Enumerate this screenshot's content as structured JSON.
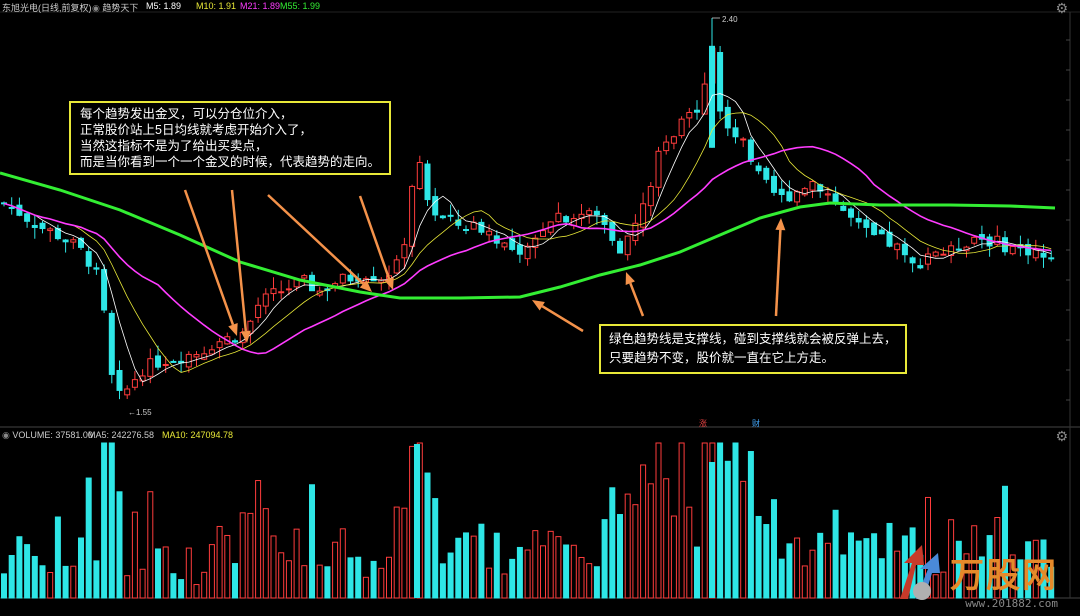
{
  "header": {
    "stock_name": "东旭光电(日线,前复权)",
    "indicator_name": "趋势天下",
    "ma_items": [
      {
        "label": "M5: 1.89",
        "color": "#ffffff"
      },
      {
        "label": "M10: 1.91",
        "color": "#e8e838"
      },
      {
        "label": "M21: 1.89",
        "color": "#ff3cff"
      },
      {
        "label": "M55: 1.99",
        "color": "#33ee33"
      }
    ]
  },
  "volume_header": {
    "label": "VOLUME: 37581.00",
    "ma5": "MA5: 242276.58",
    "ma10": "MA10: 247094.78"
  },
  "annotations": {
    "box1_lines": [
      "每个趋势发出金叉，可以分仓位介入，",
      "正常股价站上5日均线就考虑开始介入了，",
      "当然这指标不是为了给出买卖点，",
      "而是当你看到一个一个金叉的时候，代表趋势的走向。"
    ],
    "box2_lines": [
      "绿色趋势线是支撑线，碰到支撑线就会被反弹上去，",
      "只要趋势不变，股价就一直在它上方走。"
    ]
  },
  "markers": {
    "m1": "涨",
    "m2": "财"
  },
  "watermark": {
    "text": "万股网",
    "url": "www.201882.com"
  },
  "colors": {
    "up": "#ff3c3c",
    "down": "#2ee6e6",
    "m5": "#ffffff",
    "m10": "#e8e838",
    "m21": "#ff3cff",
    "m55": "#33ee33",
    "arrow": "#f4924a",
    "box": "#e8e838"
  },
  "chart_data": {
    "type": "candlestick",
    "series_count": 100,
    "high_label": "2.40",
    "low_label": "1.55",
    "price_range": [
      1.55,
      2.4
    ],
    "ma_legend": [
      "M5",
      "M10",
      "M21",
      "M55"
    ],
    "approx_closes": [
      2.0,
      1.98,
      1.97,
      1.93,
      1.89,
      1.85,
      1.72,
      1.6,
      1.58,
      1.62,
      1.66,
      1.68,
      1.67,
      1.69,
      1.7,
      1.72,
      1.74,
      1.77,
      1.78,
      1.8,
      1.82,
      1.81,
      1.85,
      1.83,
      1.82,
      1.84,
      1.83,
      1.84,
      1.86,
      1.85,
      1.86,
      1.87,
      1.98,
      2.08,
      2.0,
      1.96,
      1.95,
      1.93,
      1.92,
      1.91,
      1.9,
      1.88,
      1.92,
      1.96,
      1.98,
      1.95,
      1.93,
      1.92,
      1.9,
      1.97,
      2.05,
      2.12,
      2.25,
      2.3,
      2.15,
      2.05,
      2.08,
      2.02,
      2.0,
      2.05,
      2.04,
      2.06,
      2.03,
      2.0,
      1.98,
      1.94,
      1.92,
      1.9,
      1.93,
      1.95,
      1.93,
      1.91,
      1.89,
      1.88,
      1.86,
      1.91,
      1.92,
      1.89,
      1.9,
      1.89
    ],
    "volume_ma_legend": [
      "MA5",
      "MA10"
    ]
  }
}
